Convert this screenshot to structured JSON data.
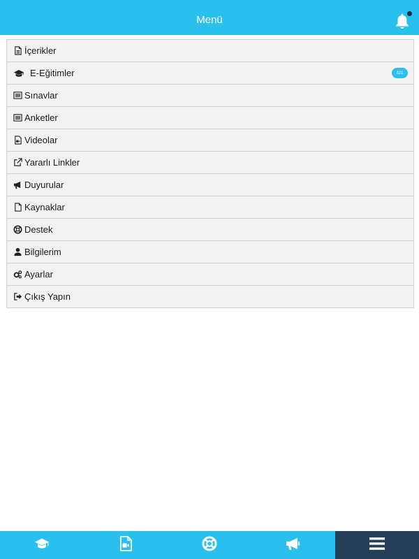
{
  "header": {
    "title": "Menü",
    "icon": "bell-icon",
    "notification_dot": true
  },
  "menu": {
    "items": [
      {
        "label": "İçerikler",
        "icon": "file-text-icon"
      },
      {
        "label": "E-Eğitimler",
        "icon": "graduation-cap-icon",
        "badge": "321"
      },
      {
        "label": "Sınavlar",
        "icon": "list-icon"
      },
      {
        "label": "Anketler",
        "icon": "list-icon"
      },
      {
        "label": "Videolar",
        "icon": "file-video-icon"
      },
      {
        "label": "Yararlı Linkler",
        "icon": "external-link-icon"
      },
      {
        "label": "Duyurular",
        "icon": "bullhorn-icon"
      },
      {
        "label": "Kaynaklar",
        "icon": "file-icon"
      },
      {
        "label": "Destek",
        "icon": "life-ring-icon"
      },
      {
        "label": "Bilgilerim",
        "icon": "user-icon"
      },
      {
        "label": "Ayarlar",
        "icon": "gears-icon"
      },
      {
        "label": "Çıkış Yapın",
        "icon": "sign-out-icon"
      }
    ]
  },
  "tabbar": {
    "tabs": [
      {
        "icon": "graduation-cap-icon",
        "active": false
      },
      {
        "icon": "file-video-icon",
        "active": false
      },
      {
        "icon": "life-ring-icon",
        "active": false
      },
      {
        "icon": "bullhorn-icon",
        "active": false
      },
      {
        "icon": "bars-icon",
        "active": true
      }
    ]
  },
  "colors": {
    "brand": "#29c0ee",
    "active_tab": "#263f58",
    "row_bg": "#f2f2f2"
  }
}
